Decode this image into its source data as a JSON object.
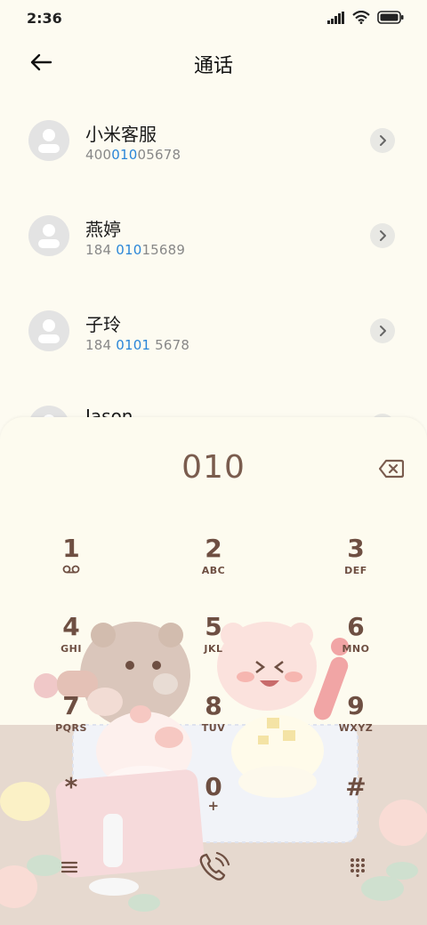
{
  "status": {
    "time": "2:36",
    "icons": [
      "signal-icon",
      "wifi-icon",
      "battery-icon"
    ]
  },
  "header": {
    "title": "通话",
    "back_icon": "back-arrow-icon"
  },
  "contacts": [
    {
      "name": "小米客服",
      "number_pre": "400",
      "number_hl": "010",
      "number_post": "05678"
    },
    {
      "name": "燕婷",
      "number_pre": "184 ",
      "number_hl": "010",
      "number_post": "15689"
    },
    {
      "name": "子玲",
      "number_pre": "184 ",
      "number_hl": "0101",
      "number_post": " 5678"
    },
    {
      "name": "Jason",
      "number_pre": "",
      "number_hl": "",
      "number_post": ""
    }
  ],
  "dialer": {
    "display": "010",
    "keys": [
      {
        "digit": "1",
        "letters": ""
      },
      {
        "digit": "2",
        "letters": "ABC"
      },
      {
        "digit": "3",
        "letters": "DEF"
      },
      {
        "digit": "4",
        "letters": "GHI"
      },
      {
        "digit": "5",
        "letters": "JKL"
      },
      {
        "digit": "6",
        "letters": "MNO"
      },
      {
        "digit": "7",
        "letters": "PQRS"
      },
      {
        "digit": "8",
        "letters": "TUV"
      },
      {
        "digit": "9",
        "letters": "WXYZ"
      },
      {
        "digit": "*",
        "letters": ""
      },
      {
        "digit": "0",
        "letters": "+"
      },
      {
        "digit": "#",
        "letters": ""
      }
    ],
    "bottom_icons": [
      "menu-icon",
      "call-icon",
      "dialpad-icon"
    ]
  },
  "colors": {
    "background": "#fdfbf1",
    "key_text": "#6e4f42",
    "highlight": "#2a86d8"
  }
}
